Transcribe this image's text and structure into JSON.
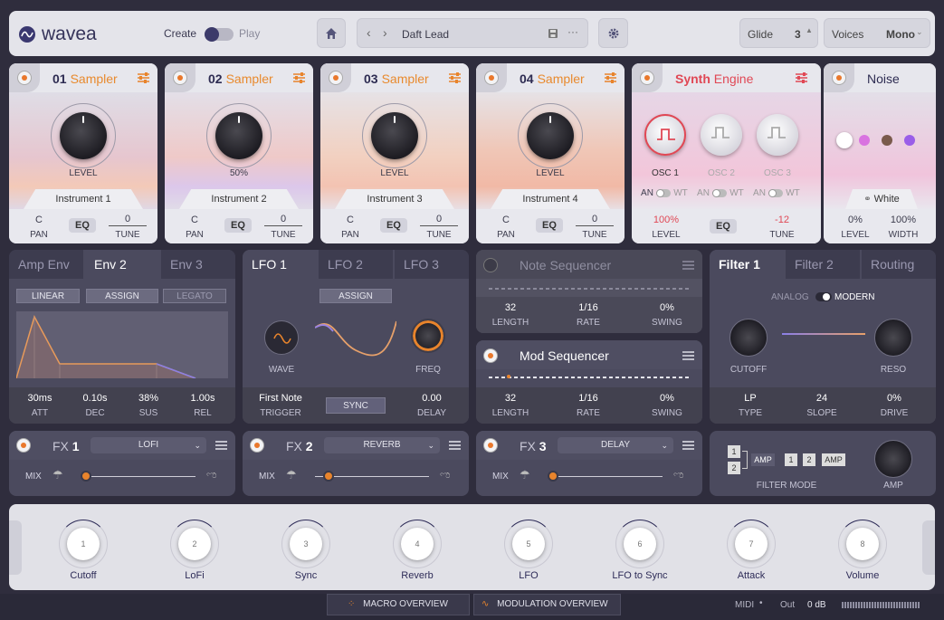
{
  "app": {
    "logo": "wavea"
  },
  "topbar": {
    "create_label": "Create",
    "play_label": "Play",
    "preset_name": "Daft Lead",
    "glide_label": "Glide",
    "glide_value": "3",
    "voices_label": "Voices",
    "voices_value": "Mono",
    "prev_glyph": "‹",
    "next_glyph": "›",
    "more_glyph": "···"
  },
  "instruments": [
    {
      "num": "01",
      "name": "Sampler",
      "knob_label": "LEVEL",
      "tag": "Instrument 1",
      "pan": "C",
      "pan_label": "PAN",
      "eq": "EQ",
      "tune": "0",
      "tune_label": "TUNE"
    },
    {
      "num": "02",
      "name": "Sampler",
      "knob_label": "50%",
      "tag": "Instrument 2",
      "pan": "C",
      "pan_label": "PAN",
      "eq": "EQ",
      "tune": "0",
      "tune_label": "TUNE"
    },
    {
      "num": "03",
      "name": "Sampler",
      "knob_label": "LEVEL",
      "tag": "Instrument 3",
      "pan": "C",
      "pan_label": "PAN",
      "eq": "EQ",
      "tune": "0",
      "tune_label": "TUNE"
    },
    {
      "num": "04",
      "name": "Sampler",
      "knob_label": "LEVEL",
      "tag": "Instrument 4",
      "pan": "C",
      "pan_label": "PAN",
      "eq": "EQ",
      "tune": "0",
      "tune_label": "TUNE"
    }
  ],
  "synth": {
    "title_a": "Synth",
    "title_b": "Engine",
    "osc": [
      "OSC 1",
      "OSC 2",
      "OSC 3"
    ],
    "an": "AN",
    "wt": "WT",
    "level": "100%",
    "level_label": "LEVEL",
    "eq": "EQ",
    "tune": "-12",
    "tune_label": "TUNE"
  },
  "noise": {
    "title": "Noise",
    "type": "White",
    "level": "0%",
    "level_label": "LEVEL",
    "width": "100%",
    "width_label": "WIDTH",
    "colors": [
      "#ffffff",
      "#d973e0",
      "#7a5a4c",
      "#9a5ee8"
    ]
  },
  "env": {
    "tabs": [
      "Amp Env",
      "Env 2",
      "Env 3"
    ],
    "buttons": [
      "LINEAR",
      "ASSIGN",
      "LEGATO"
    ],
    "values": [
      {
        "v": "30ms",
        "l": "ATT"
      },
      {
        "v": "0.10s",
        "l": "DEC"
      },
      {
        "v": "38%",
        "l": "SUS"
      },
      {
        "v": "1.00s",
        "l": "REL"
      }
    ]
  },
  "lfo": {
    "tabs": [
      "LFO 1",
      "LFO 2",
      "LFO 3"
    ],
    "assign": "ASSIGN",
    "wave_label": "WAVE",
    "freq_label": "FREQ",
    "trigger_value": "First Note",
    "trigger_label": "TRIGGER",
    "sync": "SYNC",
    "delay_value": "0.00",
    "delay_label": "DELAY"
  },
  "note_seq": {
    "title": "Note Sequencer",
    "values": [
      {
        "v": "32",
        "l": "LENGTH"
      },
      {
        "v": "1/16",
        "l": "RATE"
      },
      {
        "v": "0%",
        "l": "SWING"
      }
    ]
  },
  "mod_seq": {
    "title": "Mod Sequencer",
    "values": [
      {
        "v": "32",
        "l": "LENGTH"
      },
      {
        "v": "1/16",
        "l": "RATE"
      },
      {
        "v": "0%",
        "l": "SWING"
      }
    ]
  },
  "filter": {
    "tabs": [
      "Filter 1",
      "Filter 2",
      "Routing"
    ],
    "analog": "ANALOG",
    "modern": "MODERN",
    "cutoff_label": "CUTOFF",
    "reso_label": "RESO",
    "values": [
      {
        "v": "LP",
        "l": "TYPE"
      },
      {
        "v": "24",
        "l": "SLOPE"
      },
      {
        "v": "0%",
        "l": "DRIVE"
      }
    ],
    "mode_label": "FILTER MODE",
    "amp_label": "AMP",
    "mode_nodes": [
      "1",
      "2",
      "AMP",
      "1",
      "2",
      "AMP"
    ]
  },
  "fx": [
    {
      "prefix": "FX",
      "num": "1",
      "type": "LOFI",
      "mix": "MIX"
    },
    {
      "prefix": "FX",
      "num": "2",
      "type": "REVERB",
      "mix": "MIX"
    },
    {
      "prefix": "FX",
      "num": "3",
      "type": "DELAY",
      "mix": "MIX"
    }
  ],
  "macros": [
    {
      "n": "1",
      "label": "Cutoff"
    },
    {
      "n": "2",
      "label": "LoFi"
    },
    {
      "n": "3",
      "label": "Sync"
    },
    {
      "n": "4",
      "label": "Reverb"
    },
    {
      "n": "5",
      "label": "LFO"
    },
    {
      "n": "6",
      "label": "LFO to Sync"
    },
    {
      "n": "7",
      "label": "Attack"
    },
    {
      "n": "8",
      "label": "Volume"
    }
  ],
  "bottom": {
    "macro_overview": "MACRO OVERVIEW",
    "mod_overview": "MODULATION OVERVIEW",
    "midi": "MIDI",
    "out": "Out",
    "db": "0 dB"
  },
  "colors": {
    "accent": "#e8842c",
    "bg": "#2f2d3d",
    "panel": "#4b4a5e"
  }
}
